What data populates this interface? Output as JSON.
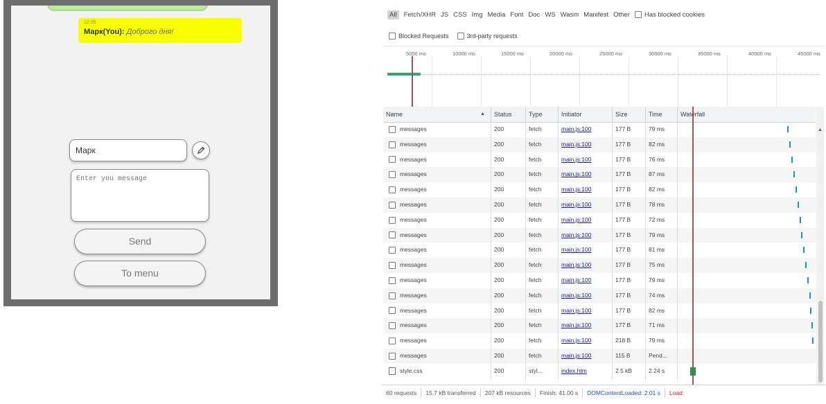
{
  "chat": {
    "message": {
      "time": "12:05",
      "author": "Марк(You):",
      "text": "Доброго дня!"
    },
    "nickname_value": "Марк",
    "message_placeholder": "Enter you message",
    "send_label": "Send",
    "menu_label": "To menu",
    "edit_icon": "pencil-icon",
    "colors": {
      "bubble": "#f7ff00",
      "frame": "#6d6d6d"
    }
  },
  "devtools": {
    "filters": [
      "All",
      "Fetch/XHR",
      "JS",
      "CSS",
      "Img",
      "Media",
      "Font",
      "Doc",
      "WS",
      "Wasm",
      "Manifest",
      "Other"
    ],
    "has_blocked_cookies": "Has blocked cookies",
    "blocked_requests": "Blocked Requests",
    "third_party": "3rd-party requests",
    "timeline_ticks": [
      "5000 ms",
      "10000 ms",
      "15000 ms",
      "20000 ms",
      "25000 ms",
      "30000 ms",
      "35000 ms",
      "40000 ms",
      "45000 ms"
    ],
    "columns": {
      "name": "Name",
      "status": "Status",
      "type": "Type",
      "initiator": "Initiator",
      "size": "Size",
      "time": "Time",
      "waterfall": "Waterfall"
    },
    "rows": [
      {
        "name": "messages",
        "status": "200",
        "type": "fetch",
        "initiator": "main.js:100",
        "size": "177 B",
        "time": "79 ms",
        "wf": 0.81
      },
      {
        "name": "messages",
        "status": "200",
        "type": "fetch",
        "initiator": "main.js:100",
        "size": "177 B",
        "time": "82 ms",
        "wf": 0.825
      },
      {
        "name": "messages",
        "status": "200",
        "type": "fetch",
        "initiator": "main.js:100",
        "size": "177 B",
        "time": "76 ms",
        "wf": 0.84
      },
      {
        "name": "messages",
        "status": "200",
        "type": "fetch",
        "initiator": "main.js:100",
        "size": "177 B",
        "time": "87 ms",
        "wf": 0.855
      },
      {
        "name": "messages",
        "status": "200",
        "type": "fetch",
        "initiator": "main.js:100",
        "size": "177 B",
        "time": "82 ms",
        "wf": 0.87
      },
      {
        "name": "messages",
        "status": "200",
        "type": "fetch",
        "initiator": "main.js:100",
        "size": "177 B",
        "time": "78 ms",
        "wf": 0.885
      },
      {
        "name": "messages",
        "status": "200",
        "type": "fetch",
        "initiator": "main.js:100",
        "size": "177 B",
        "time": "72 ms",
        "wf": 0.9
      },
      {
        "name": "messages",
        "status": "200",
        "type": "fetch",
        "initiator": "main.js:100",
        "size": "177 B",
        "time": "79 ms",
        "wf": 0.915
      },
      {
        "name": "messages",
        "status": "200",
        "type": "fetch",
        "initiator": "main.js:100",
        "size": "177 B",
        "time": "81 ms",
        "wf": 0.93
      },
      {
        "name": "messages",
        "status": "200",
        "type": "fetch",
        "initiator": "main.js:100",
        "size": "177 B",
        "time": "75 ms",
        "wf": 0.945
      },
      {
        "name": "messages",
        "status": "200",
        "type": "fetch",
        "initiator": "main.js:100",
        "size": "177 B",
        "time": "79 ms",
        "wf": 0.96
      },
      {
        "name": "messages",
        "status": "200",
        "type": "fetch",
        "initiator": "main.js:100",
        "size": "177 B",
        "time": "74 ms",
        "wf": 0.972
      },
      {
        "name": "messages",
        "status": "200",
        "type": "fetch",
        "initiator": "main.js:100",
        "size": "177 B",
        "time": "82 ms",
        "wf": 0.982
      },
      {
        "name": "messages",
        "status": "200",
        "type": "fetch",
        "initiator": "main.js:100",
        "size": "177 B",
        "time": "71 ms",
        "wf": 0.99
      },
      {
        "name": "messages",
        "status": "200",
        "type": "fetch",
        "initiator": "main.js:100",
        "size": "218 B",
        "time": "79 ms",
        "wf": 0.995
      },
      {
        "name": "messages",
        "status": "200",
        "type": "fetch",
        "initiator": "main.js:100",
        "size": "115 B",
        "time": "Pend...",
        "wf": null
      },
      {
        "name": "style.css",
        "status": "200",
        "type": "styl...",
        "initiator": "index.htm",
        "size": "2.5 kB",
        "time": "2.24 s",
        "wf": 0,
        "css": true
      }
    ],
    "status_bar": {
      "requests": "60 requests",
      "transferred": "15.7 kB transferred",
      "resources": "207 kB resources",
      "finish": "Finish: 41.00 s",
      "dom_loaded": "DOMContentLoaded: 2.01 s",
      "load": "Load:"
    }
  }
}
